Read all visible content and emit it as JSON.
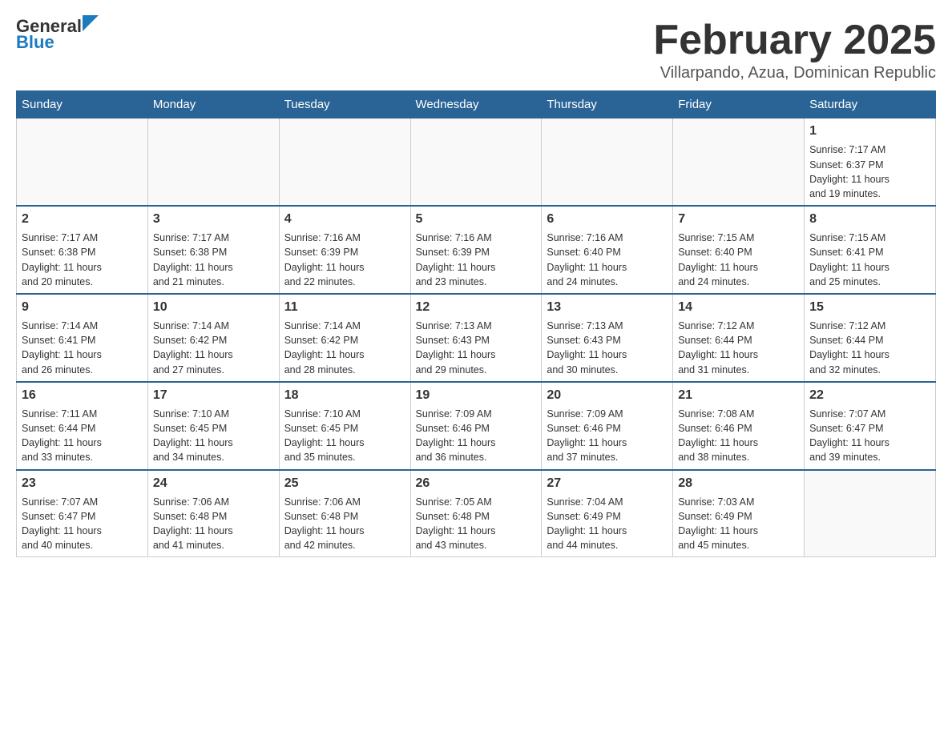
{
  "header": {
    "logo_general": "General",
    "logo_blue": "Blue",
    "title": "February 2025",
    "location": "Villarpando, Azua, Dominican Republic"
  },
  "calendar": {
    "days_of_week": [
      "Sunday",
      "Monday",
      "Tuesday",
      "Wednesday",
      "Thursday",
      "Friday",
      "Saturday"
    ],
    "weeks": [
      {
        "days": [
          {
            "number": "",
            "info": ""
          },
          {
            "number": "",
            "info": ""
          },
          {
            "number": "",
            "info": ""
          },
          {
            "number": "",
            "info": ""
          },
          {
            "number": "",
            "info": ""
          },
          {
            "number": "",
            "info": ""
          },
          {
            "number": "1",
            "info": "Sunrise: 7:17 AM\nSunset: 6:37 PM\nDaylight: 11 hours\nand 19 minutes."
          }
        ]
      },
      {
        "days": [
          {
            "number": "2",
            "info": "Sunrise: 7:17 AM\nSunset: 6:38 PM\nDaylight: 11 hours\nand 20 minutes."
          },
          {
            "number": "3",
            "info": "Sunrise: 7:17 AM\nSunset: 6:38 PM\nDaylight: 11 hours\nand 21 minutes."
          },
          {
            "number": "4",
            "info": "Sunrise: 7:16 AM\nSunset: 6:39 PM\nDaylight: 11 hours\nand 22 minutes."
          },
          {
            "number": "5",
            "info": "Sunrise: 7:16 AM\nSunset: 6:39 PM\nDaylight: 11 hours\nand 23 minutes."
          },
          {
            "number": "6",
            "info": "Sunrise: 7:16 AM\nSunset: 6:40 PM\nDaylight: 11 hours\nand 24 minutes."
          },
          {
            "number": "7",
            "info": "Sunrise: 7:15 AM\nSunset: 6:40 PM\nDaylight: 11 hours\nand 24 minutes."
          },
          {
            "number": "8",
            "info": "Sunrise: 7:15 AM\nSunset: 6:41 PM\nDaylight: 11 hours\nand 25 minutes."
          }
        ]
      },
      {
        "days": [
          {
            "number": "9",
            "info": "Sunrise: 7:14 AM\nSunset: 6:41 PM\nDaylight: 11 hours\nand 26 minutes."
          },
          {
            "number": "10",
            "info": "Sunrise: 7:14 AM\nSunset: 6:42 PM\nDaylight: 11 hours\nand 27 minutes."
          },
          {
            "number": "11",
            "info": "Sunrise: 7:14 AM\nSunset: 6:42 PM\nDaylight: 11 hours\nand 28 minutes."
          },
          {
            "number": "12",
            "info": "Sunrise: 7:13 AM\nSunset: 6:43 PM\nDaylight: 11 hours\nand 29 minutes."
          },
          {
            "number": "13",
            "info": "Sunrise: 7:13 AM\nSunset: 6:43 PM\nDaylight: 11 hours\nand 30 minutes."
          },
          {
            "number": "14",
            "info": "Sunrise: 7:12 AM\nSunset: 6:44 PM\nDaylight: 11 hours\nand 31 minutes."
          },
          {
            "number": "15",
            "info": "Sunrise: 7:12 AM\nSunset: 6:44 PM\nDaylight: 11 hours\nand 32 minutes."
          }
        ]
      },
      {
        "days": [
          {
            "number": "16",
            "info": "Sunrise: 7:11 AM\nSunset: 6:44 PM\nDaylight: 11 hours\nand 33 minutes."
          },
          {
            "number": "17",
            "info": "Sunrise: 7:10 AM\nSunset: 6:45 PM\nDaylight: 11 hours\nand 34 minutes."
          },
          {
            "number": "18",
            "info": "Sunrise: 7:10 AM\nSunset: 6:45 PM\nDaylight: 11 hours\nand 35 minutes."
          },
          {
            "number": "19",
            "info": "Sunrise: 7:09 AM\nSunset: 6:46 PM\nDaylight: 11 hours\nand 36 minutes."
          },
          {
            "number": "20",
            "info": "Sunrise: 7:09 AM\nSunset: 6:46 PM\nDaylight: 11 hours\nand 37 minutes."
          },
          {
            "number": "21",
            "info": "Sunrise: 7:08 AM\nSunset: 6:46 PM\nDaylight: 11 hours\nand 38 minutes."
          },
          {
            "number": "22",
            "info": "Sunrise: 7:07 AM\nSunset: 6:47 PM\nDaylight: 11 hours\nand 39 minutes."
          }
        ]
      },
      {
        "days": [
          {
            "number": "23",
            "info": "Sunrise: 7:07 AM\nSunset: 6:47 PM\nDaylight: 11 hours\nand 40 minutes."
          },
          {
            "number": "24",
            "info": "Sunrise: 7:06 AM\nSunset: 6:48 PM\nDaylight: 11 hours\nand 41 minutes."
          },
          {
            "number": "25",
            "info": "Sunrise: 7:06 AM\nSunset: 6:48 PM\nDaylight: 11 hours\nand 42 minutes."
          },
          {
            "number": "26",
            "info": "Sunrise: 7:05 AM\nSunset: 6:48 PM\nDaylight: 11 hours\nand 43 minutes."
          },
          {
            "number": "27",
            "info": "Sunrise: 7:04 AM\nSunset: 6:49 PM\nDaylight: 11 hours\nand 44 minutes."
          },
          {
            "number": "28",
            "info": "Sunrise: 7:03 AM\nSunset: 6:49 PM\nDaylight: 11 hours\nand 45 minutes."
          },
          {
            "number": "",
            "info": ""
          }
        ]
      }
    ]
  }
}
